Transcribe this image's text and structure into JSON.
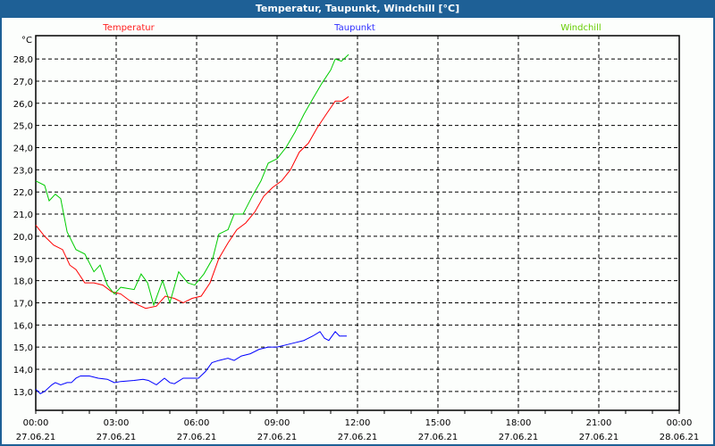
{
  "window": {
    "title": "Temperatur, Taupunkt, Windchill [°C]"
  },
  "chart_data": {
    "type": "line",
    "title": "Temperatur, Taupunkt, Windchill [°C]",
    "ylabel": "°C",
    "xlabel": "",
    "xlim_hours": [
      0,
      24
    ],
    "ylim": [
      12.15,
      29.05
    ],
    "grid": true,
    "legend_placement": "top",
    "y_ticks": [
      13,
      14,
      15,
      16,
      17,
      18,
      19,
      20,
      21,
      22,
      23,
      24,
      25,
      26,
      27,
      28
    ],
    "y_tick_labels": [
      "13,0",
      "14,0",
      "15,0",
      "16,0",
      "17,0",
      "18,0",
      "19,0",
      "20,0",
      "21,0",
      "22,0",
      "23,0",
      "24,0",
      "25,0",
      "26,0",
      "27,0",
      "28,0"
    ],
    "x_ticks": [
      {
        "hour": 0,
        "time": "00:00",
        "date": "27.06.21"
      },
      {
        "hour": 3,
        "time": "03:00",
        "date": "27.06.21"
      },
      {
        "hour": 6,
        "time": "06:00",
        "date": "27.06.21"
      },
      {
        "hour": 9,
        "time": "09:00",
        "date": "27.06.21"
      },
      {
        "hour": 12,
        "time": "12:00",
        "date": "27.06.21"
      },
      {
        "hour": 15,
        "time": "15:00",
        "date": "27.06.21"
      },
      {
        "hour": 18,
        "time": "18:00",
        "date": "27.06.21"
      },
      {
        "hour": 21,
        "time": "21:00",
        "date": "27.06.21"
      },
      {
        "hour": 24,
        "time": "00:00",
        "date": "28.06.21"
      }
    ],
    "series": [
      {
        "name": "Temperatur",
        "color": "#ff0000",
        "label_color": "#ff2020",
        "points": [
          [
            0,
            20.5
          ],
          [
            0.33,
            20.0
          ],
          [
            0.67,
            19.6
          ],
          [
            1.0,
            19.4
          ],
          [
            1.27,
            18.7
          ],
          [
            1.5,
            18.5
          ],
          [
            1.83,
            17.9
          ],
          [
            2.17,
            17.9
          ],
          [
            2.5,
            17.8
          ],
          [
            2.83,
            17.5
          ],
          [
            3.17,
            17.4
          ],
          [
            3.5,
            17.1
          ],
          [
            3.83,
            16.9
          ],
          [
            4.1,
            16.75
          ],
          [
            4.5,
            16.85
          ],
          [
            4.83,
            17.3
          ],
          [
            5.17,
            17.2
          ],
          [
            5.5,
            17.0
          ],
          [
            5.83,
            17.2
          ],
          [
            6.17,
            17.3
          ],
          [
            6.5,
            17.9
          ],
          [
            6.83,
            19.0
          ],
          [
            7.17,
            19.7
          ],
          [
            7.5,
            20.3
          ],
          [
            7.83,
            20.6
          ],
          [
            8.17,
            21.1
          ],
          [
            8.5,
            21.8
          ],
          [
            8.83,
            22.2
          ],
          [
            9.17,
            22.5
          ],
          [
            9.5,
            23.0
          ],
          [
            9.83,
            23.8
          ],
          [
            10.17,
            24.2
          ],
          [
            10.5,
            24.9
          ],
          [
            10.83,
            25.5
          ],
          [
            11.17,
            26.1
          ],
          [
            11.43,
            26.1
          ],
          [
            11.67,
            26.3
          ]
        ]
      },
      {
        "name": "Taupunkt",
        "color": "#0000ff",
        "label_color": "#3030ff",
        "points": [
          [
            0,
            13.1
          ],
          [
            0.17,
            12.9
          ],
          [
            0.33,
            13.0
          ],
          [
            0.6,
            13.3
          ],
          [
            0.73,
            13.4
          ],
          [
            0.93,
            13.3
          ],
          [
            1.17,
            13.4
          ],
          [
            1.33,
            13.4
          ],
          [
            1.5,
            13.6
          ],
          [
            1.67,
            13.7
          ],
          [
            2.0,
            13.7
          ],
          [
            2.33,
            13.6
          ],
          [
            2.67,
            13.55
          ],
          [
            2.93,
            13.4
          ],
          [
            3.17,
            13.45
          ],
          [
            3.67,
            13.5
          ],
          [
            4.0,
            13.55
          ],
          [
            4.2,
            13.5
          ],
          [
            4.5,
            13.3
          ],
          [
            4.8,
            13.6
          ],
          [
            5.0,
            13.4
          ],
          [
            5.17,
            13.35
          ],
          [
            5.5,
            13.6
          ],
          [
            5.83,
            13.6
          ],
          [
            6.07,
            13.6
          ],
          [
            6.33,
            13.9
          ],
          [
            6.57,
            14.3
          ],
          [
            6.83,
            14.4
          ],
          [
            7.17,
            14.5
          ],
          [
            7.4,
            14.4
          ],
          [
            7.67,
            14.6
          ],
          [
            8.0,
            14.7
          ],
          [
            8.33,
            14.9
          ],
          [
            8.67,
            15.0
          ],
          [
            9.0,
            15.0
          ],
          [
            9.33,
            15.1
          ],
          [
            9.67,
            15.2
          ],
          [
            10.0,
            15.3
          ],
          [
            10.33,
            15.5
          ],
          [
            10.6,
            15.7
          ],
          [
            10.77,
            15.4
          ],
          [
            10.93,
            15.3
          ],
          [
            11.17,
            15.7
          ],
          [
            11.33,
            15.5
          ],
          [
            11.6,
            15.5
          ]
        ]
      },
      {
        "name": "Windchill",
        "color": "#00cc00",
        "label_color": "#66cc00",
        "points": [
          [
            0,
            22.5
          ],
          [
            0.33,
            22.3
          ],
          [
            0.5,
            21.6
          ],
          [
            0.73,
            21.9
          ],
          [
            0.93,
            21.7
          ],
          [
            1.17,
            20.2
          ],
          [
            1.5,
            19.4
          ],
          [
            1.83,
            19.2
          ],
          [
            2.17,
            18.4
          ],
          [
            2.4,
            18.7
          ],
          [
            2.67,
            17.8
          ],
          [
            2.93,
            17.4
          ],
          [
            3.17,
            17.7
          ],
          [
            3.67,
            17.6
          ],
          [
            3.93,
            18.3
          ],
          [
            4.17,
            17.9
          ],
          [
            4.4,
            16.9
          ],
          [
            4.73,
            18.0
          ],
          [
            5.0,
            17.0
          ],
          [
            5.33,
            18.4
          ],
          [
            5.67,
            17.9
          ],
          [
            5.93,
            17.8
          ],
          [
            6.27,
            18.3
          ],
          [
            6.6,
            19.0
          ],
          [
            6.83,
            20.1
          ],
          [
            7.17,
            20.3
          ],
          [
            7.4,
            21.0
          ],
          [
            7.73,
            21.0
          ],
          [
            8.07,
            21.8
          ],
          [
            8.4,
            22.5
          ],
          [
            8.67,
            23.3
          ],
          [
            9.0,
            23.5
          ],
          [
            9.33,
            24.0
          ],
          [
            9.67,
            24.7
          ],
          [
            10.0,
            25.5
          ],
          [
            10.33,
            26.2
          ],
          [
            10.67,
            26.9
          ],
          [
            11.0,
            27.5
          ],
          [
            11.17,
            28.0
          ],
          [
            11.4,
            27.9
          ],
          [
            11.67,
            28.2
          ]
        ]
      }
    ]
  }
}
